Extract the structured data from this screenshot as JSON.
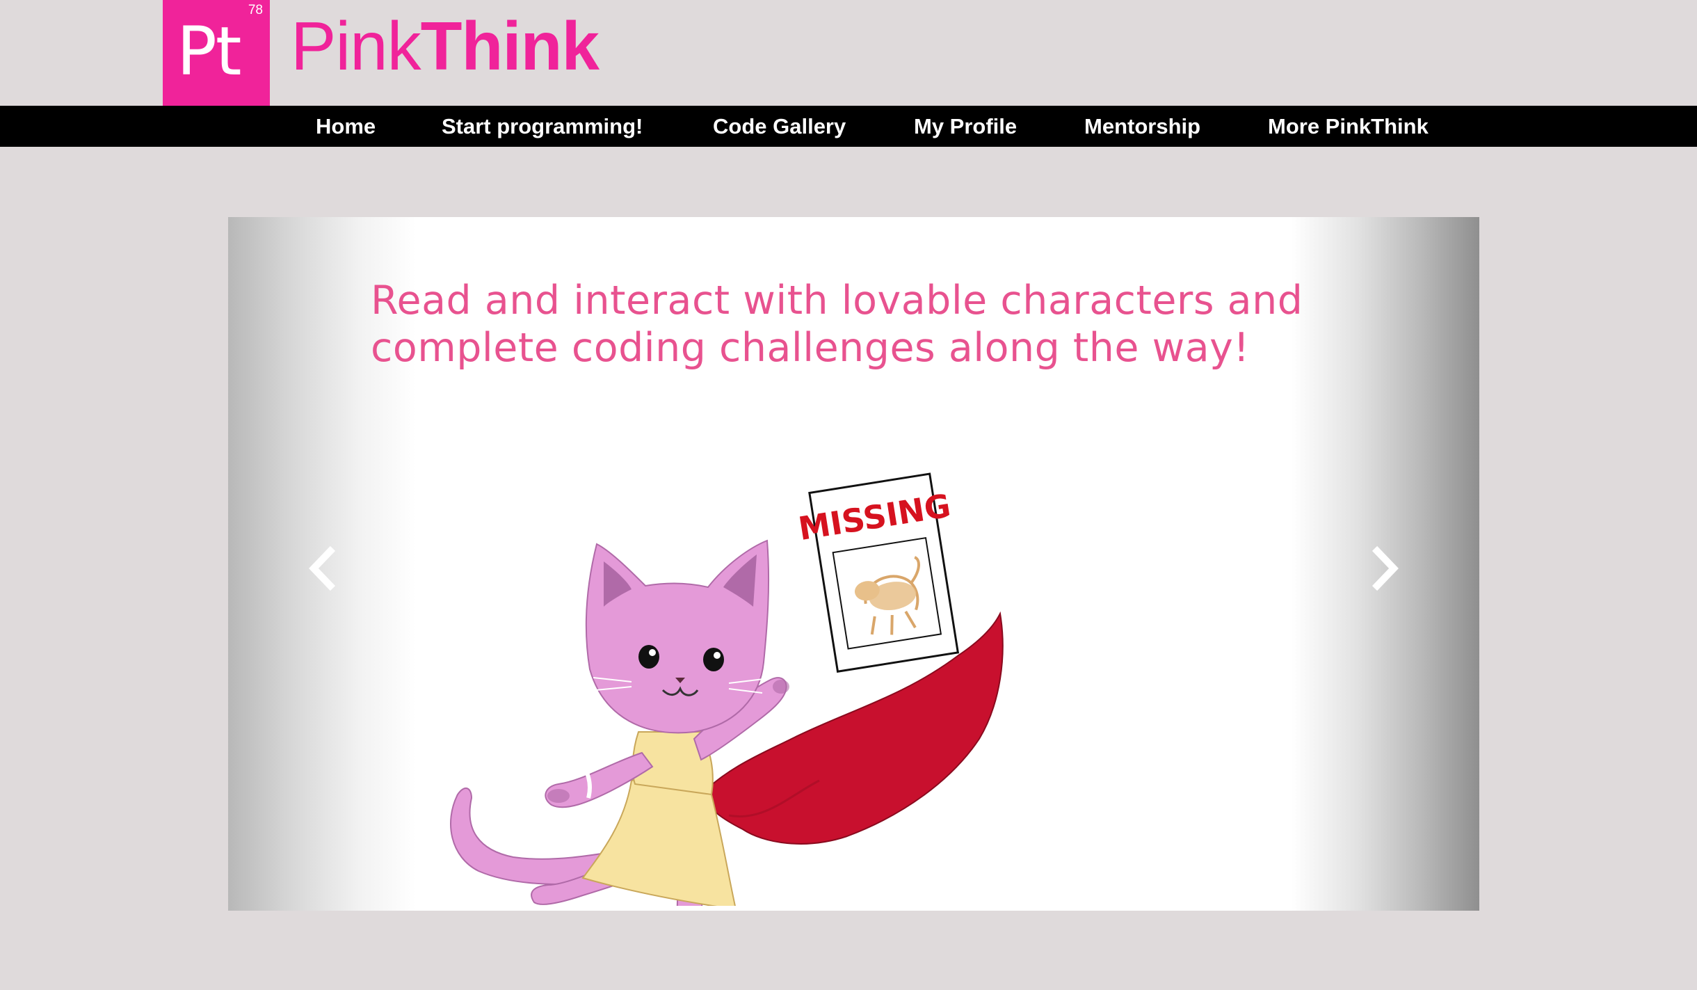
{
  "logo": {
    "symbol": "Pt",
    "number": "78",
    "brand_light": "Pink",
    "brand_bold": "Think"
  },
  "nav": {
    "items": [
      {
        "label": "Home"
      },
      {
        "label": "Start programming!"
      },
      {
        "label": "Code Gallery"
      },
      {
        "label": "My Profile"
      },
      {
        "label": "Mentorship"
      },
      {
        "label": "More PinkThink"
      }
    ]
  },
  "carousel": {
    "caption_line1": "Read and interact with lovable characters and",
    "caption_line2": "complete coding challenges along the way!",
    "poster_text": "MISSING",
    "prev_icon": "chevron-left-icon",
    "next_icon": "chevron-right-icon"
  },
  "colors": {
    "brand": "#f0239a",
    "background": "#dfdadb",
    "nav_bg": "#000000",
    "caption": "#e8528f",
    "cat": "#e49ad8",
    "cape": "#c8102e",
    "dress": "#f7e3a0"
  }
}
